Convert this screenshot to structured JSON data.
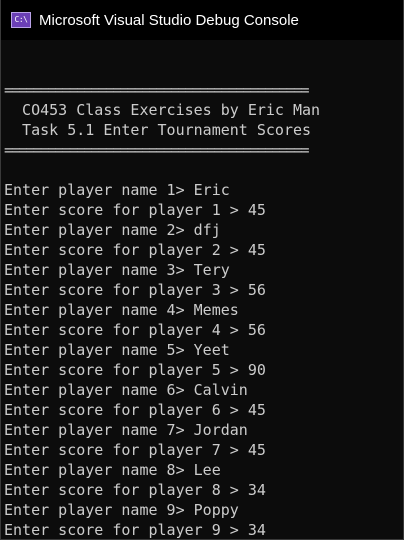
{
  "window": {
    "title": "Microsoft Visual Studio Debug Console",
    "icon_label": "C:\\"
  },
  "console": {
    "lines": [
      "",
      "==========================================",
      "  CO453 Class Exercises by Eric Man",
      "  Task 5.1 Enter Tournament Scores",
      "==========================================",
      "",
      "Enter player name 1> Eric",
      "Enter score for player 1 > 45",
      "Enter player name 2> dfj",
      "Enter score for player 2 > 45",
      "Enter player name 3> Tery",
      "Enter score for player 3 > 56",
      "Enter player name 4> Memes",
      "Enter score for player 4 > 56",
      "Enter player name 5> Yeet",
      "Enter score for player 5 > 90",
      "Enter player name 6> Calvin",
      "Enter score for player 6 > 45",
      "Enter player name 7> Jordan",
      "Enter score for player 7 > 45",
      "Enter player name 8> Lee",
      "Enter score for player 8 > 34",
      "Enter player name 9> Poppy",
      "Enter score for player 9 > 34"
    ]
  }
}
